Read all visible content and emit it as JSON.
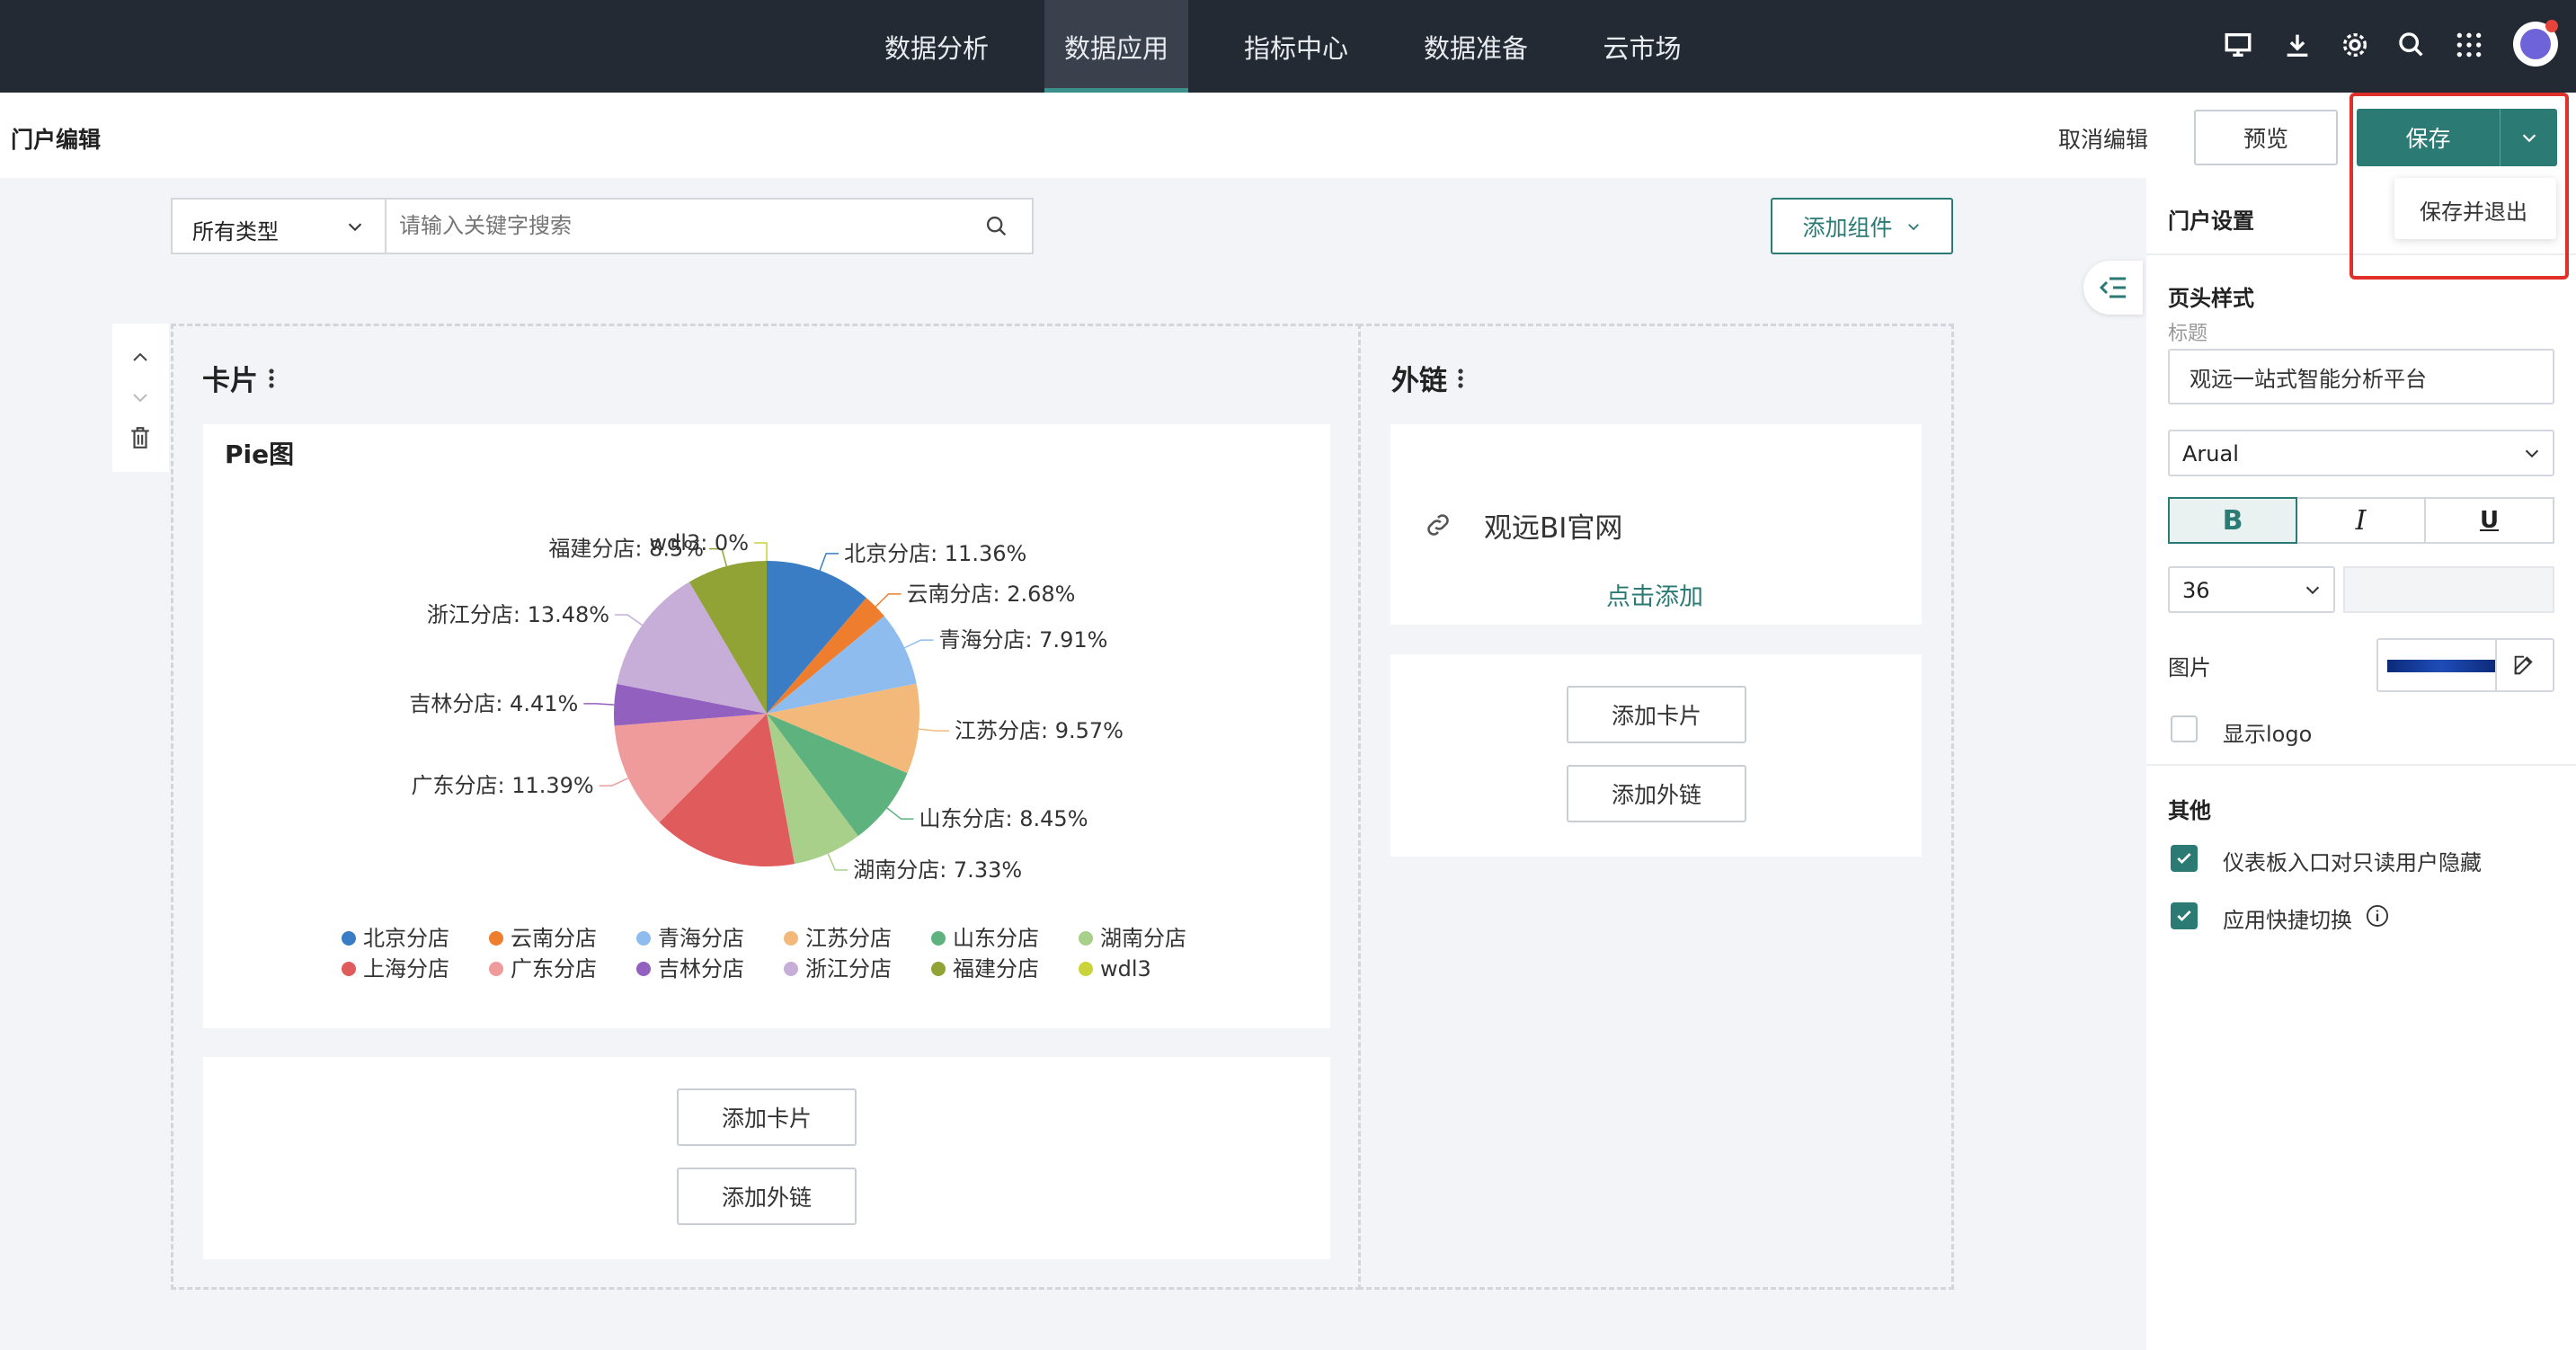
{
  "nav": {
    "tabs": [
      {
        "label": "数据分析",
        "active": false
      },
      {
        "label": "数据应用",
        "active": true
      },
      {
        "label": "指标中心",
        "active": false
      },
      {
        "label": "数据准备",
        "active": false
      },
      {
        "label": "云市场",
        "active": false
      }
    ],
    "icons": [
      "monitor-icon",
      "download-icon",
      "settings-icon",
      "search-icon",
      "apps-grid-icon",
      "avatar"
    ]
  },
  "editbar": {
    "title": "门户编辑",
    "cancel": "取消编辑",
    "preview": "预览",
    "save": "保存",
    "save_exit": "保存并退出"
  },
  "toolbar": {
    "type_select": "所有类型",
    "search_placeholder": "请输入关键字搜索",
    "add_component": "添加组件"
  },
  "card_section": {
    "title": "卡片",
    "chart_title": "Pie图",
    "add_card": "添加卡片",
    "add_link": "添加外链"
  },
  "link_section": {
    "title": "外链",
    "link_text": "观远BI官网",
    "add_click": "点击添加",
    "add_card": "添加卡片",
    "add_link": "添加外链"
  },
  "settings": {
    "title": "门户设置",
    "header_style": "页头样式",
    "title_label": "标题",
    "title_value": "观远一站式智能分析平台",
    "font": "Arual",
    "bold": "B",
    "italic": "I",
    "underline": "U",
    "font_size": "36",
    "image_label": "图片",
    "show_logo": "显示logo",
    "show_logo_checked": false,
    "other": "其他",
    "opt1": "仪表板入口对只读用户隐藏",
    "opt1_checked": true,
    "opt2": "应用快捷切换",
    "opt2_checked": true
  },
  "colors": {
    "accent": "#2c7a74",
    "nav_bg": "#242a33",
    "highlight": "#e0302a"
  },
  "chart_data": {
    "type": "pie",
    "title": "Pie图",
    "slices": [
      {
        "name": "北京分店",
        "pct": 11.36,
        "label": "北京分店: 11.36%",
        "color": "#3a7dc4"
      },
      {
        "name": "云南分店",
        "pct": 2.68,
        "label": "云南分店: 2.68%",
        "color": "#ee7d2e"
      },
      {
        "name": "青海分店",
        "pct": 7.91,
        "label": "青海分店: 7.91%",
        "color": "#8fbcee"
      },
      {
        "name": "江苏分店",
        "pct": 9.57,
        "label": "江苏分店: 9.57%",
        "color": "#f3b97a"
      },
      {
        "name": "山东分店",
        "pct": 8.45,
        "label": "山东分店: 8.45%",
        "color": "#5db27d"
      },
      {
        "name": "湖南分店",
        "pct": 7.33,
        "label": "湖南分店: 7.33%",
        "color": "#a8d08a"
      },
      {
        "name": "上海分店",
        "pct": 15.39,
        "label": "",
        "color": "#e05c5c"
      },
      {
        "name": "广东分店",
        "pct": 11.39,
        "label": "广东分店: 11.39%",
        "color": "#f09b9b"
      },
      {
        "name": "吉林分店",
        "pct": 4.41,
        "label": "吉林分店: 4.41%",
        "color": "#9260bf"
      },
      {
        "name": "浙江分店",
        "pct": 13.48,
        "label": "浙江分店: 13.48%",
        "color": "#c6aed8"
      },
      {
        "name": "福建分店",
        "pct": 8.5,
        "label": "福建分店: 8.5%",
        "color": "#92a336"
      },
      {
        "name": "wdl3",
        "pct": 0,
        "label": "wdl3: 0%",
        "color": "#c9d43a"
      }
    ],
    "legend": "bottom"
  }
}
